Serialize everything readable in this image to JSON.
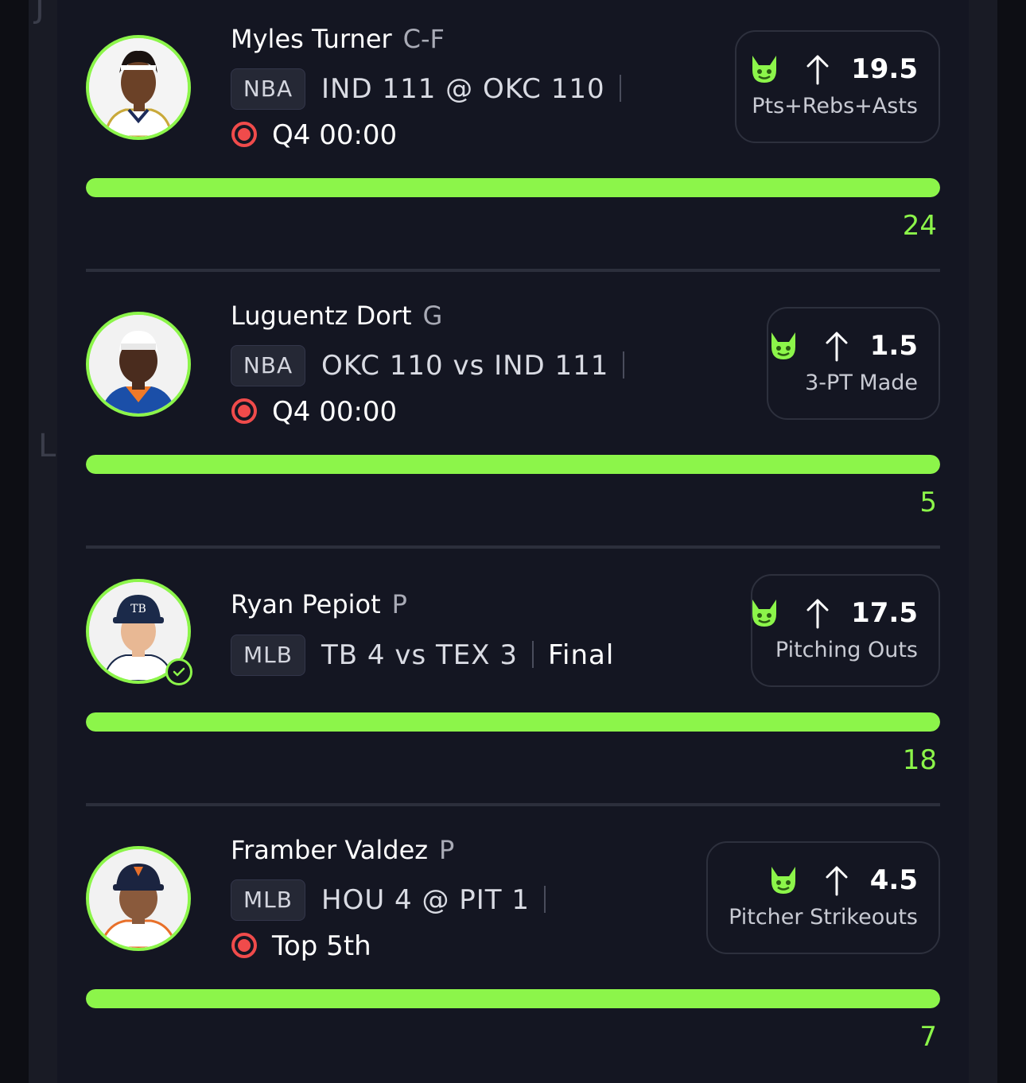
{
  "colors": {
    "accent": "#8cf54a",
    "live": "#f04b4b",
    "background": "#141622",
    "card_border": "#2d303d"
  },
  "background_hints": {
    "left_top": "J",
    "left_mid": "L"
  },
  "entries": [
    {
      "player": "Myles Turner",
      "position": "C-F",
      "league": "NBA",
      "game": "IND 111 @ OKC 110",
      "status": "Q4 00:00",
      "status_live": true,
      "pick_direction": "up",
      "pick_icon": "demon-icon",
      "line": "19.5",
      "stat": "Pts+Rebs+Asts",
      "result": "24",
      "progress": 1.0,
      "verified": false
    },
    {
      "player": "Luguentz Dort",
      "position": "G",
      "league": "NBA",
      "game": "OKC 110 vs IND 111",
      "status": "Q4 00:00",
      "status_live": true,
      "pick_direction": "up",
      "pick_icon": "demon-icon",
      "line": "1.5",
      "stat": "3-PT Made",
      "result": "5",
      "progress": 1.0,
      "verified": false
    },
    {
      "player": "Ryan Pepiot",
      "position": "P",
      "league": "MLB",
      "game": "TB 4 vs TEX 3",
      "status": "Final",
      "status_live": false,
      "pick_direction": "up",
      "pick_icon": "demon-icon",
      "line": "17.5",
      "stat": "Pitching Outs",
      "result": "18",
      "progress": 1.0,
      "verified": true
    },
    {
      "player": "Framber Valdez",
      "position": "P",
      "league": "MLB",
      "game": "HOU 4 @ PIT 1",
      "status": "Top 5th",
      "status_live": true,
      "pick_direction": "up",
      "pick_icon": "demon-icon",
      "line": "4.5",
      "stat": "Pitcher Strikeouts",
      "result": "7",
      "progress": 1.0,
      "verified": false
    }
  ]
}
